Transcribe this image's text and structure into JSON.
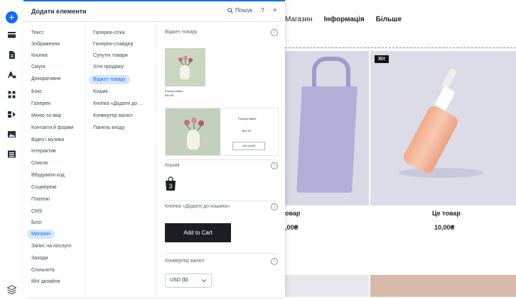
{
  "panel": {
    "title": "Додати елементи",
    "search_label": "Пошук",
    "help_label": "?",
    "close_label": "×"
  },
  "categories": [
    "Текст",
    "Зображення",
    "Кнопка",
    "Смуга",
    "Декоративне",
    "Бокс",
    "Галерея",
    "Меню та якір",
    "Контакти й форми",
    "Відео і музика",
    "Інтерактив",
    "Список",
    "Вбудувати код",
    "Соцмережі",
    "Платежі",
    "CMS",
    "Блог",
    "Магазин",
    "Запис на послуги",
    "Заходи",
    "Спільнота",
    "Мої дизайни"
  ],
  "selected_category": "Магазин",
  "subcategories": [
    "Галерея-сітка",
    "Галерея-слайдер",
    "Супутні товари",
    "Хіти продажу",
    "Віджет товару",
    "Кошик",
    "Кнопка «Додати до ...",
    "Конвертер валют",
    "Панель входу"
  ],
  "selected_subcategory": "Віджет товару",
  "sections": {
    "product_widget": {
      "title": "Віджет товару",
      "small_name": "Product Name",
      "small_price": "$49.95",
      "large_name": "Product Name",
      "large_dash": "—",
      "large_price": "$49.99",
      "large_button": "View details"
    },
    "cart": {
      "title": "Кошик",
      "count": "3"
    },
    "add_to_cart": {
      "title": "Кнопка «Додати до кошика»",
      "button": "Add to Cart"
    },
    "currency_converter": {
      "title": "Конвертер валют",
      "value": "USD ($)"
    }
  },
  "site": {
    "nav": [
      "Магазин",
      "Інформація",
      "Більше"
    ],
    "products": [
      {
        "title": "овар",
        "price": ",00₴"
      },
      {
        "badge": "Хіт",
        "title": "Це товар",
        "price": "10,00₴"
      }
    ]
  },
  "colors": {
    "accent": "#116dff",
    "selected_bg": "#d6e6fe"
  }
}
